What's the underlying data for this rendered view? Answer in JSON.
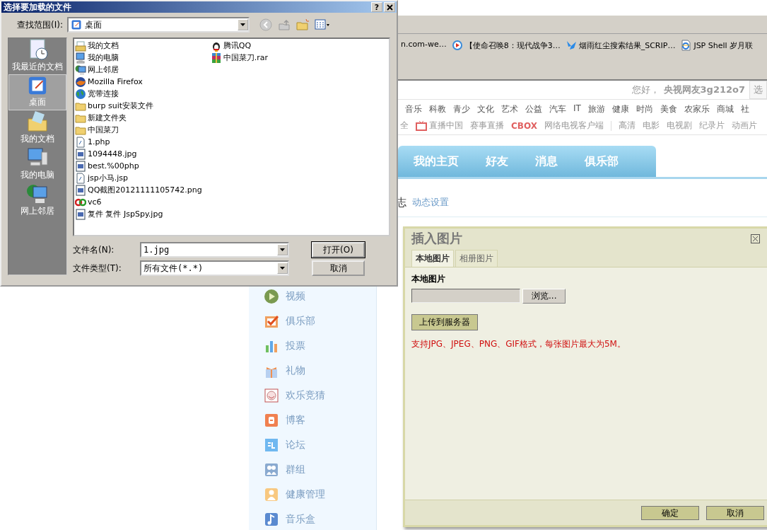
{
  "browser": {
    "bookmarks": [
      {
        "label": "n.com-we…",
        "kind": "none"
      },
      {
        "label": "【使命召唤8：现代战争3…",
        "kind": "video"
      },
      {
        "label": "烟雨红尘搜索结果_SCRIP…",
        "kind": "butterfly"
      },
      {
        "label": "JSP Shell 岁月联",
        "kind": "page"
      }
    ],
    "greeting": "您好，",
    "user": "央视网友3g212o7",
    "user_menu": "选",
    "channels": [
      "音乐",
      "科教",
      "青少",
      "文化",
      "艺术",
      "公益",
      "汽车",
      "IT",
      "旅游",
      "健康",
      "时尚",
      "美食",
      "农家乐",
      "商城",
      "社"
    ],
    "sub_links": [
      {
        "label": "全",
        "kind": "text"
      },
      {
        "label": "直播中国",
        "kind": "tv"
      },
      {
        "label": "赛事直播",
        "kind": "text"
      },
      {
        "label": "CBOX",
        "kind": "logo"
      },
      {
        "label": "网络电视客户端",
        "kind": "text"
      },
      {
        "kind": "separator"
      },
      {
        "label": "高清",
        "kind": "text"
      },
      {
        "label": "电影",
        "kind": "text"
      },
      {
        "label": "电视剧",
        "kind": "text"
      },
      {
        "label": "纪录片",
        "kind": "text"
      },
      {
        "label": "动画片",
        "kind": "text"
      }
    ],
    "tabs": [
      "我的主页",
      "好友",
      "消息",
      "俱乐部"
    ],
    "section_title": "志",
    "section_link": "动态设置",
    "menu": [
      {
        "label": "视频",
        "kind": "video"
      },
      {
        "label": "俱乐部",
        "kind": "club"
      },
      {
        "label": "投票",
        "kind": "vote"
      },
      {
        "label": "礼物",
        "kind": "gift"
      },
      {
        "label": "欢乐竞猜",
        "kind": "guess"
      },
      {
        "label": "博客",
        "kind": "blog"
      },
      {
        "label": "论坛",
        "kind": "forum"
      },
      {
        "label": "群组",
        "kind": "group"
      },
      {
        "label": "健康管理",
        "kind": "health"
      },
      {
        "label": "音乐盒",
        "kind": "music"
      }
    ]
  },
  "insert_dialog": {
    "title": "插入图片",
    "tabs": [
      {
        "label": "本地图片",
        "selected": true
      },
      {
        "label": "相册图片",
        "selected": false
      }
    ],
    "field_label": "本地图片",
    "browse_button": "浏览...",
    "upload_button": "上传到服务器",
    "note": "支持JPG、JPEG、PNG、GIF格式，每张图片最大为5M。",
    "buttons": [
      "确定",
      "取消"
    ]
  },
  "file_dialog": {
    "title": "选择要加载的文件",
    "help": "?",
    "look_in_label": "查找范围(I):",
    "look_in": "桌面",
    "places": [
      {
        "label": "我最近的文档",
        "kind": "recent",
        "selected": false
      },
      {
        "label": "桌面",
        "kind": "desktop",
        "selected": true
      },
      {
        "label": "我的文档",
        "kind": "documents",
        "selected": false
      },
      {
        "label": "我的电脑",
        "kind": "computer",
        "selected": false
      },
      {
        "label": "网上邻居",
        "kind": "network",
        "selected": false
      }
    ],
    "files": [
      {
        "name": "我的文档",
        "kind": "documents"
      },
      {
        "name": "我的电脑",
        "kind": "computer"
      },
      {
        "name": "网上邻居",
        "kind": "network"
      },
      {
        "name": "Mozilla Firefox",
        "kind": "browser"
      },
      {
        "name": "宽带连接",
        "kind": "globe"
      },
      {
        "name": "burp suit安装文件",
        "kind": "folder"
      },
      {
        "name": "新建文件夹",
        "kind": "folder"
      },
      {
        "name": "中国菜刀",
        "kind": "folder"
      },
      {
        "name": "1.php",
        "kind": "file"
      },
      {
        "name": "1094448.jpg",
        "kind": "image"
      },
      {
        "name": "best.%00php",
        "kind": "image"
      },
      {
        "name": "jsp小马.jsp",
        "kind": "file"
      },
      {
        "name": "QQ截图20121111105742.png",
        "kind": "image"
      },
      {
        "name": "vc6",
        "kind": "app"
      },
      {
        "name": "复件 复件 JspSpy.jpg",
        "kind": "image"
      },
      {
        "name": "腾讯QQ",
        "kind": "penguin"
      },
      {
        "name": "中国菜刀.rar",
        "kind": "archive"
      }
    ],
    "file_name_label": "文件名(N):",
    "file_name": "1.jpg",
    "file_type_label": "文件类型(T):",
    "file_type": "所有文件(*.*)",
    "buttons": [
      "打开(O)",
      "取消"
    ]
  }
}
